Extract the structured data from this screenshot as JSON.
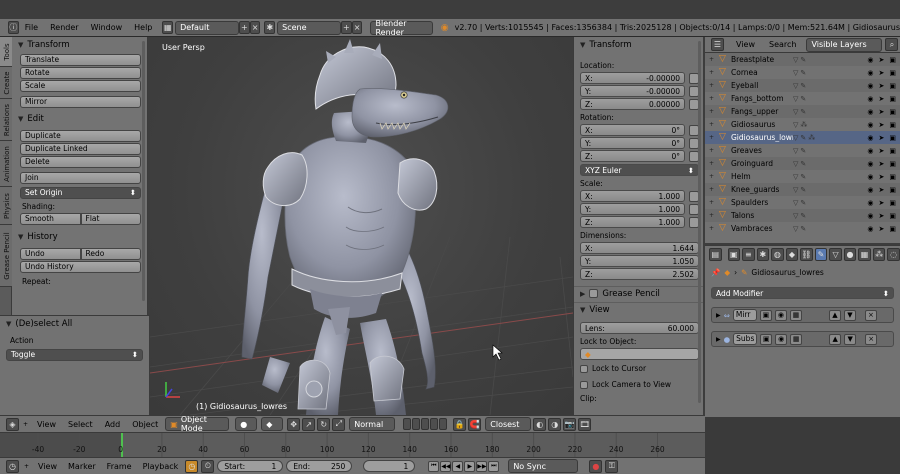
{
  "topbar": {
    "menus": [
      "File",
      "Render",
      "Window",
      "Help"
    ],
    "layout": "Default",
    "scene": "Scene",
    "engine": "Blender Render",
    "stats": "v2.70 | Verts:1015545 | Faces:1356384 | Tris:2025128 | Objects:0/14 | Lamps:0/0 | Mem:521.64M | Gidiosaurus"
  },
  "tool_tabs": [
    "Tools",
    "Create",
    "Relations",
    "Animation",
    "Physics",
    "Grease Pencil"
  ],
  "tool_shelf": {
    "transform_title": "Transform",
    "translate": "Translate",
    "rotate": "Rotate",
    "scale": "Scale",
    "mirror": "Mirror",
    "edit_title": "Edit",
    "duplicate": "Duplicate",
    "duplicate_linked": "Duplicate Linked",
    "delete": "Delete",
    "join": "Join",
    "set_origin": "Set Origin",
    "shading_label": "Shading:",
    "smooth": "Smooth",
    "flat": "Flat",
    "history_title": "History",
    "undo": "Undo",
    "redo": "Redo",
    "undo_history": "Undo History",
    "repeat_label": "Repeat:"
  },
  "redo_panel": {
    "title": "(De)select All",
    "action_label": "Action",
    "action_value": "Toggle"
  },
  "viewport": {
    "view_label": "User Persp",
    "object_label": "(1) Gidiosaurus_lowres"
  },
  "npanel": {
    "title": "Transform",
    "location_label": "Location:",
    "location": [
      {
        "k": "X:",
        "v": "-0.00000"
      },
      {
        "k": "Y:",
        "v": "-0.00000"
      },
      {
        "k": "Z:",
        "v": "0.00000"
      }
    ],
    "rotation_label": "Rotation:",
    "rotation": [
      {
        "k": "X:",
        "v": "0°"
      },
      {
        "k": "Y:",
        "v": "0°"
      },
      {
        "k": "Z:",
        "v": "0°"
      }
    ],
    "rotation_mode": "XYZ Euler",
    "scale_label": "Scale:",
    "scale": [
      {
        "k": "X:",
        "v": "1.000"
      },
      {
        "k": "Y:",
        "v": "1.000"
      },
      {
        "k": "Z:",
        "v": "1.000"
      }
    ],
    "dimensions_label": "Dimensions:",
    "dimensions": [
      {
        "k": "X:",
        "v": "1.644"
      },
      {
        "k": "Y:",
        "v": "1.050"
      },
      {
        "k": "Z:",
        "v": "2.502"
      }
    ],
    "grease_pencil": "Grease Pencil",
    "view_title": "View",
    "lens_label": "Lens:",
    "lens_value": "60.000",
    "lock_to_object": "Lock to Object:",
    "lock_to_cursor": "Lock to Cursor",
    "lock_camera": "Lock Camera to View",
    "clip_label": "Clip:"
  },
  "outliner": {
    "view": "View",
    "search": "Search",
    "filter": "Visible Layers",
    "items": [
      "Breastplate",
      "Cornea",
      "Eyeball",
      "Fangs_bottom",
      "Fangs_upper",
      "Gidiosaurus",
      "Gidiosaurus_lowres",
      "Greaves",
      "Groinguard",
      "Helm",
      "Knee_guards",
      "Spaulders",
      "Talons",
      "Vambraces"
    ],
    "selected_index": 6
  },
  "properties": {
    "object_name": "Gidiosaurus_lowres",
    "add_modifier": "Add Modifier",
    "modifiers": [
      "Mirr",
      "Subs"
    ]
  },
  "vp_header": {
    "menus": [
      "View",
      "Select",
      "Add",
      "Object"
    ],
    "mode": "Object Mode",
    "pivot": "Normal",
    "snap": "Closest"
  },
  "timeline": {
    "ticks": [
      "-40",
      "-20",
      "0",
      "20",
      "40",
      "60",
      "80",
      "100",
      "120",
      "140",
      "160",
      "180",
      "200",
      "220",
      "240",
      "260"
    ],
    "menus": [
      "View",
      "Marker",
      "Frame",
      "Playback"
    ],
    "start_label": "Start:",
    "start_value": "1",
    "end_label": "End:",
    "end_value": "250",
    "current": "1",
    "sync": "No Sync"
  },
  "colors": {
    "panel": "#727272",
    "viewport_bg": "#3d3d3d",
    "selection": "#566686",
    "object_orange": "#e08a28",
    "frame_green": "#4fc04f"
  }
}
